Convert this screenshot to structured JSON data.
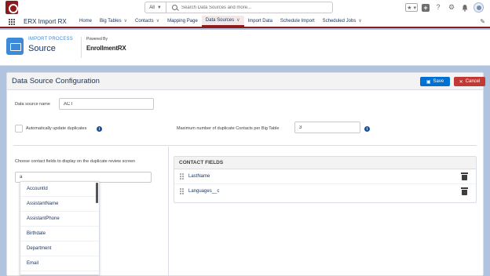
{
  "global_header": {
    "search_scope": "All",
    "search_placeholder": "Search Data Sources and more...",
    "icons": [
      "favorites-star-icon",
      "favorites-chevron-icon",
      "global-actions-plus-icon",
      "help-icon",
      "setup-gear-icon",
      "notifications-bell-icon",
      "user-avatar"
    ]
  },
  "nav": {
    "app_name": "ERX Import RX",
    "items": [
      {
        "label": "Home",
        "has_menu": false,
        "active": false
      },
      {
        "label": "Big Tables",
        "has_menu": true,
        "active": false
      },
      {
        "label": "Contacts",
        "has_menu": true,
        "active": false
      },
      {
        "label": "Mapping Page",
        "has_menu": false,
        "active": false
      },
      {
        "label": "Data Sources",
        "has_menu": true,
        "active": true
      },
      {
        "label": "Import Data",
        "has_menu": false,
        "active": false
      },
      {
        "label": "Schedule Import",
        "has_menu": false,
        "active": false
      },
      {
        "label": "Scheduled Jobs",
        "has_menu": true,
        "active": false
      }
    ],
    "accent_color": "#8e1b1b"
  },
  "page_header": {
    "object_label": "IMPORT PROCESS",
    "title": "Source",
    "powered_by": "Powered By",
    "brand": "EnrollmentRX"
  },
  "card": {
    "title": "Data Source Configuration",
    "save_label": "Save",
    "cancel_label": "Cancel",
    "save_color": "#0070d2",
    "cancel_color": "#c23934"
  },
  "form": {
    "data_source_name_label": "Data source name",
    "data_source_name_value": "ACT",
    "auto_update_label": "Automatically update duplicates",
    "auto_update_checked": false,
    "max_duplicates_label": "Maximum number of duplicate Contacts per Big Table",
    "max_duplicates_value": "3",
    "choose_fields_label": "Choose contact fields to display on the duplicate review screen",
    "choose_fields_value": "a"
  },
  "dropdown_options": [
    "AccountId",
    "AssistantName",
    "AssistantPhone",
    "Birthdate",
    "Department",
    "Email"
  ],
  "contact_fields": {
    "header": "CONTACT FIELDS",
    "items": [
      "LastName",
      "Languages__c"
    ]
  }
}
